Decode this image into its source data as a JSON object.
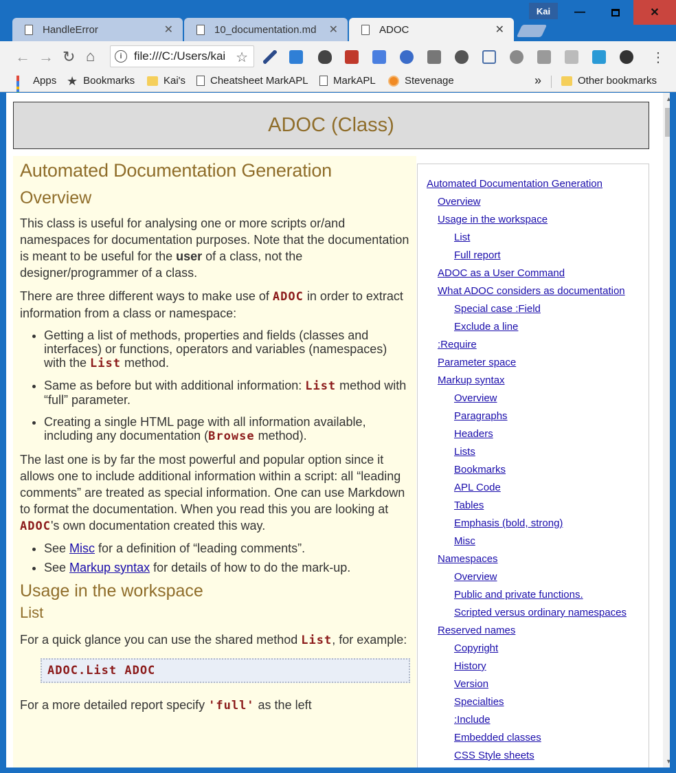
{
  "browser": {
    "tabs": [
      {
        "title": "HandleError",
        "active": false
      },
      {
        "title": "10_documentation.md",
        "active": false
      },
      {
        "title": "ADOC",
        "active": true
      }
    ],
    "profile_name": "Kai",
    "address": "file:///C:/Users/kai",
    "bookmarks": [
      {
        "label": "Apps",
        "icon": "apps-grid-icon"
      },
      {
        "label": "Bookmarks",
        "icon": "star-icon"
      },
      {
        "label": "Kai's",
        "icon": "folder-icon"
      },
      {
        "label": "Cheatsheet MarkAPL",
        "icon": "page-icon"
      },
      {
        "label": "MarkAPL",
        "icon": "page-icon"
      },
      {
        "label": "Stevenage",
        "icon": "stevenage-icon"
      }
    ],
    "bookmarks_overflow": "»",
    "other_bookmarks": "Other bookmarks"
  },
  "page": {
    "header_title": "ADOC (Class)",
    "h_main": "Automated Documentation Generation",
    "h_overview": "Overview",
    "p1_a": "This class is useful for analysing one or more scripts or/and namespaces for documentation purposes. Note that the documentation is meant to be useful for the ",
    "p1_bold": "user",
    "p1_b": " of a class, not the designer/programmer of a class.",
    "p2_a": "There are three different ways to make use of ",
    "p2_code": "ADOC",
    "p2_b": " in order to extract information from a class or namespace:",
    "li1_a": "Getting a list of methods, properties and fields (classes and interfaces) or functions, operators and variables (namespaces) with the ",
    "li1_code": "List",
    "li1_b": " method.",
    "li2_a": "Same as before but with additional information: ",
    "li2_code": "List",
    "li2_b": " method with “full” parameter.",
    "li3_a": "Creating a single HTML page with all information available, including any documentation (",
    "li3_code": "Browse",
    "li3_b": " method).",
    "p3_a": "The last one is by far the most powerful and popular option since it allows one to include additional information within a script: all “leading comments” are treated as special information. One can use Markdown to format the documentation. When you read this you are looking at ",
    "p3_code": "ADOC",
    "p3_b": "'s own documentation created this way.",
    "li4_a": "See ",
    "li4_link": "Misc",
    "li4_b": " for a definition of “leading comments”.",
    "li5_a": "See ",
    "li5_link": "Markup syntax",
    "li5_b": " for details of how to do the mark-up.",
    "h_usage": "Usage in the workspace",
    "h_list": "List",
    "p4_a": "For a quick glance you can use the shared method ",
    "p4_code": "List",
    "p4_b": ", for example:",
    "code_block": "ADOC.List ADOC",
    "p5_a": "For a more detailed report specify ",
    "p5_code": "'full'",
    "p5_b": " as the left"
  },
  "toc": [
    {
      "label": "Automated Documentation Generation",
      "level": 1
    },
    {
      "label": "Overview",
      "level": 2
    },
    {
      "label": "Usage in the workspace",
      "level": 2
    },
    {
      "label": "List",
      "level": 3
    },
    {
      "label": "Full report",
      "level": 3
    },
    {
      "label": "ADOC as a User Command",
      "level": 2
    },
    {
      "label": "What ADOC considers as documentation",
      "level": 2
    },
    {
      "label": "Special case :Field",
      "level": 3
    },
    {
      "label": "Exclude a line",
      "level": 3
    },
    {
      "label": ":Require",
      "level": 2
    },
    {
      "label": "Parameter space",
      "level": 2
    },
    {
      "label": "Markup syntax",
      "level": 2
    },
    {
      "label": "Overview",
      "level": 3
    },
    {
      "label": "Paragraphs",
      "level": 3
    },
    {
      "label": "Headers",
      "level": 3
    },
    {
      "label": "Lists",
      "level": 3
    },
    {
      "label": "Bookmarks",
      "level": 3
    },
    {
      "label": "APL Code",
      "level": 3
    },
    {
      "label": "Tables",
      "level": 3
    },
    {
      "label": "Emphasis (bold, strong)",
      "level": 3
    },
    {
      "label": "Misc",
      "level": 3
    },
    {
      "label": "Namespaces",
      "level": 2
    },
    {
      "label": "Overview",
      "level": 3
    },
    {
      "label": "Public and private functions.",
      "level": 3
    },
    {
      "label": "Scripted versus ordinary namespaces",
      "level": 3
    },
    {
      "label": "Reserved names",
      "level": 2
    },
    {
      "label": "Copyright",
      "level": 3
    },
    {
      "label": "History",
      "level": 3
    },
    {
      "label": "Version",
      "level": 3
    },
    {
      "label": "Specialties",
      "level": 3
    },
    {
      "label": ":Include",
      "level": 3
    },
    {
      "label": "Embedded classes",
      "level": 3
    },
    {
      "label": "CSS Style sheets",
      "level": 3
    }
  ],
  "colors": {
    "heading": "#8f6d2a",
    "content_bg": "#fffde6",
    "code": "#8b1a1a",
    "link": "#1a0dab",
    "titlebar": "#1a6fc2"
  }
}
